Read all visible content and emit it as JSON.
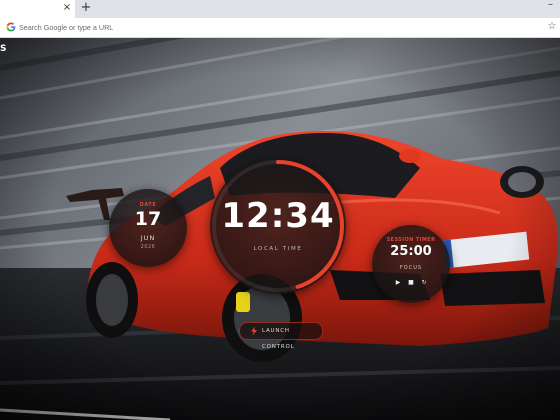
{
  "browser": {
    "tab_close_glyph": "×",
    "new_tab_glyph": "+",
    "minimize_glyph": "–",
    "omnibox_placeholder": "Search Google or type a URL",
    "bookmark_glyph": "☆"
  },
  "corner_logo": "S",
  "date_widget": {
    "label": "DATE",
    "day": "17",
    "month": "JUN",
    "year": "2026"
  },
  "clock_widget": {
    "time": "12:34",
    "label": "LOCAL TIME",
    "progress": 0.45,
    "accent": "#e8422c"
  },
  "session_widget": {
    "label": "SESSION TIMER",
    "time": "25:00",
    "mode": "FOCUS",
    "play_glyph": "▶",
    "stop_glyph": "■",
    "reset_glyph": "↻"
  },
  "launch_button": {
    "label": "LAUNCH CONTROL",
    "icon": "bolt-icon"
  },
  "colors": {
    "accent": "#e8422c",
    "car": "#d8331f"
  }
}
